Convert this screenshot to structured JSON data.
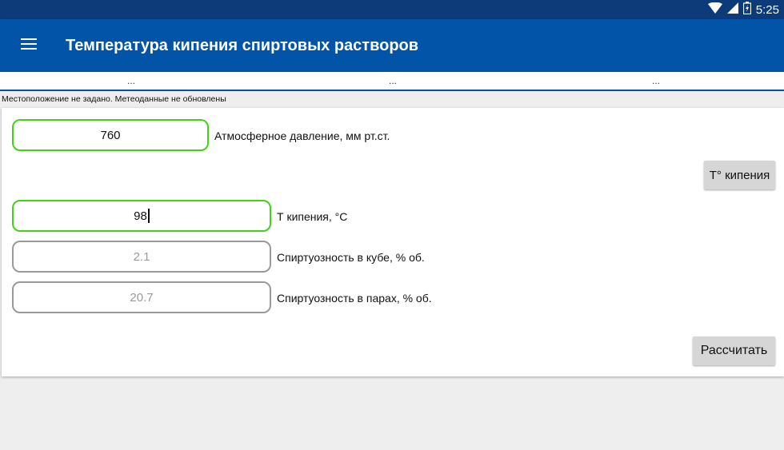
{
  "status_bar": {
    "time": "5:25"
  },
  "app_bar": {
    "title": "Температура кипения спиртовых растворов"
  },
  "weather": {
    "cells": [
      "...",
      "...",
      "..."
    ]
  },
  "location_status": "Местоположение не задано. Метеоданные не обновлены",
  "form": {
    "pressure": {
      "value": "760",
      "label": "Атмосферное давление, мм рт.ст."
    },
    "boiling_button": "T° кипения",
    "boiling_temp": {
      "value": "98",
      "label": "Т кипения, °С"
    },
    "cube_alcohol": {
      "value": "2.1",
      "label": "Спиртуозность в кубе, % об."
    },
    "vapor_alcohol": {
      "value": "20.7",
      "label": "Спиртуозность в парах, % об."
    },
    "calculate_button": "Рассчитать"
  }
}
